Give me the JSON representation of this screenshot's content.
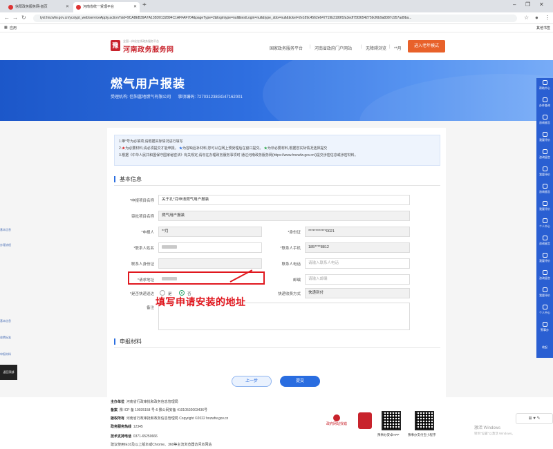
{
  "browser": {
    "tabs": [
      {
        "label": "信阳政务服务网-首页"
      },
      {
        "label": "河南省统一受理平台"
      }
    ],
    "new_tab": "+",
    "window_controls": {
      "minimize": "–",
      "restore": "❐",
      "close": "✕"
    },
    "url": "tysl.hnzwfw.gov.cn/ycslypt_web/serviceApply.action?sid=9CA8EB39A7A135D0132894C1AFFAF704&pageType=2&logintype=null&testLogin=null&type_sblx=null&ticket=2e189c4562e647719b3199f1fa3edf75f36542759cf6b9a8387c957ad9ba...",
    "bookmarks": {
      "apps": "应用",
      "other": "其他书签"
    }
  },
  "site_header": {
    "logo_sub": "全国一体化在线政务服务平台",
    "logo_title": "河南政务服务网",
    "nav": [
      "国家政务服务平台",
      "河南省政府门户网站",
      "无障碍浏览",
      "**月"
    ],
    "elder_button": "进入老年模式"
  },
  "banner": {
    "title": "燃气用户报装",
    "agency_label": "受理机构:",
    "agency": "信阳富地燃气有限公司",
    "code_label": "事项编码:",
    "code": "727031238GG47162001"
  },
  "left_panel": {
    "items": [
      "基本信息",
      "办理流程",
      "基本信息",
      "收费标准",
      "申报材料"
    ],
    "dark_label": "返回顶部"
  },
  "notice": {
    "line1": "1.带*号为必填项,请根据实际情况进行填写",
    "line2_a": "为必要材料,请必须提交才能申报。",
    "line2_b": "为容缺后补材料,您可以在网上预受理后在窗口提交。",
    "line2_c": "为非必要材料,根据您实际情况选择提交",
    "line3": "3.根据《中华人民共和国保守国家秘密法》有关规定,请勿在办理政务服务事项时 通过河南政务服务网(https://www.hnzwfw.gov.cn/)提交涉密信息或涉密材料。"
  },
  "form": {
    "section_basic": "基本信息",
    "section_materials": "申报材料",
    "apply_item_label": "*申报项目名称",
    "apply_item_value": "关于孔*月申请燃气用户报装",
    "approve_item_label": "审批项目名称",
    "approve_item_value": "燃气用户报装",
    "applicant_label": "*申报人",
    "applicant_value": "**月",
    "idcard_label": "*身份证",
    "idcard_value": "************0021",
    "contact_name_label": "*联系人姓名",
    "contact_phone_label": "*联系人手机",
    "contact_phone_value": "185****8812",
    "contact_id_label": "联系人身份证",
    "contact_tel_label": "联系人电话",
    "contact_tel_placeholder": "请输入联系人电话",
    "address_label": "*请求地址",
    "email_label": "邮编",
    "email_placeholder": "请输入邮编",
    "express_label": "*是否快递送达",
    "express_yes": "是",
    "express_no": "否",
    "express_method_label": "快递收费方式",
    "express_method_value": "快递到付",
    "remark_label": "备注"
  },
  "annotation": "填写申请安装的地址",
  "buttons": {
    "prev": "上一步",
    "submit": "提交"
  },
  "right_sidebar": [
    "帮助中心",
    "办件查询",
    "咨询留言",
    "我要评价",
    "咨询留言",
    "我要评价",
    "咨询留言",
    "我要评价",
    "个人中心",
    "咨询留言",
    "我要评价",
    "咨询留言",
    "我要评价",
    "个人中心",
    "警事办",
    "收起"
  ],
  "footer": {
    "host_label": "主办单位",
    "host": "河南省行政审批和政务信息管理局",
    "icp_label": "备案",
    "icp": "豫 ICP 备 19035158 号-6 豫公网安备 41010502003436号",
    "copyright_label": "版权所有",
    "copyright": "河南省行政审批和政务信息管理局 Copyright ©2022 hnzwfw.gov.cn",
    "hotline_label": "政务服务热线",
    "hotline": "12345",
    "support_label": "技术支持电话",
    "support": "0371-65250666",
    "browser_tip": "建议使用IE10及以上版本或Chrome、360等主流浏览器访问本网站",
    "gov_badge": "政府网站找错",
    "qr1_label": "豫事办安卓APP",
    "qr2_label": "豫事办支付宝小程序",
    "float_tool": "⊞ ♥ ✎"
  },
  "watermark": {
    "line1": "激活 Windows",
    "line2": "转到\"设置\"以激活 Windows。"
  }
}
